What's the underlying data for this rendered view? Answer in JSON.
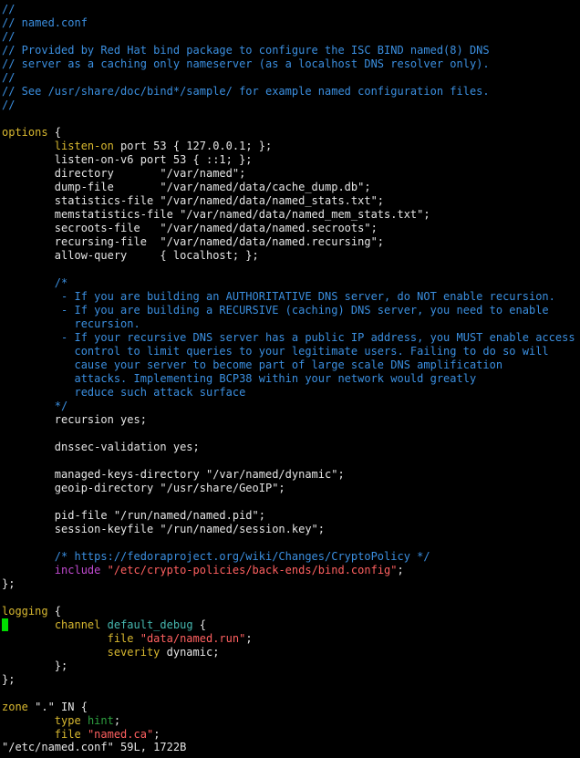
{
  "editor": {
    "lines": [
      [
        {
          "t": "//",
          "c": "comment"
        }
      ],
      [
        {
          "t": "// named.conf",
          "c": "comment"
        }
      ],
      [
        {
          "t": "//",
          "c": "comment"
        }
      ],
      [
        {
          "t": "// Provided by Red Hat bind package to configure the ISC BIND named(8) DNS",
          "c": "comment"
        }
      ],
      [
        {
          "t": "// server as a caching only nameserver (as a localhost DNS resolver only).",
          "c": "comment"
        }
      ],
      [
        {
          "t": "//",
          "c": "comment"
        }
      ],
      [
        {
          "t": "// See /usr/share/doc/bind*/sample/ for example named configuration files.",
          "c": "comment"
        }
      ],
      [
        {
          "t": "//",
          "c": "comment"
        }
      ],
      [
        {
          "t": "",
          "c": "plain"
        }
      ],
      [
        {
          "t": "options",
          "c": "keyword"
        },
        {
          "t": " {",
          "c": "plain"
        }
      ],
      [
        {
          "t": "        ",
          "c": "plain"
        },
        {
          "t": "listen-on",
          "c": "keyword"
        },
        {
          "t": " port 53 { 127.0.0.1; };",
          "c": "plain"
        }
      ],
      [
        {
          "t": "        listen-on-v6 port 53 { ::1; };",
          "c": "plain"
        }
      ],
      [
        {
          "t": "        directory       \"/var/named\";",
          "c": "plain"
        }
      ],
      [
        {
          "t": "        dump-file       \"/var/named/data/cache_dump.db\";",
          "c": "plain"
        }
      ],
      [
        {
          "t": "        statistics-file \"/var/named/data/named_stats.txt\";",
          "c": "plain"
        }
      ],
      [
        {
          "t": "        memstatistics-file \"/var/named/data/named_mem_stats.txt\";",
          "c": "plain"
        }
      ],
      [
        {
          "t": "        secroots-file   \"/var/named/data/named.secroots\";",
          "c": "plain"
        }
      ],
      [
        {
          "t": "        recursing-file  \"/var/named/data/named.recursing\";",
          "c": "plain"
        }
      ],
      [
        {
          "t": "        allow-query     { localhost; };",
          "c": "plain"
        }
      ],
      [
        {
          "t": "",
          "c": "plain"
        }
      ],
      [
        {
          "t": "        /*",
          "c": "comment"
        }
      ],
      [
        {
          "t": "         - If you are building an AUTHORITATIVE DNS server, do NOT enable recursion.",
          "c": "comment"
        }
      ],
      [
        {
          "t": "         - If you are building a RECURSIVE (caching) DNS server, you need to enable",
          "c": "comment"
        }
      ],
      [
        {
          "t": "           recursion.",
          "c": "comment"
        }
      ],
      [
        {
          "t": "         - If your recursive DNS server has a public IP address, you MUST enable access",
          "c": "comment"
        }
      ],
      [
        {
          "t": "           control to limit queries to your legitimate users. Failing to do so will",
          "c": "comment"
        }
      ],
      [
        {
          "t": "           cause your server to become part of large scale DNS amplification",
          "comment": "",
          "c": "comment"
        }
      ],
      [
        {
          "t": "           attacks. Implementing BCP38 within your network would greatly",
          "c": "comment"
        }
      ],
      [
        {
          "t": "           reduce such attack surface",
          "c": "comment"
        }
      ],
      [
        {
          "t": "        */",
          "c": "comment"
        }
      ],
      [
        {
          "t": "        recursion yes;",
          "c": "plain"
        }
      ],
      [
        {
          "t": "",
          "c": "plain"
        }
      ],
      [
        {
          "t": "        dnssec-validation yes;",
          "c": "plain"
        }
      ],
      [
        {
          "t": "",
          "c": "plain"
        }
      ],
      [
        {
          "t": "        managed-keys-directory \"/var/named/dynamic\";",
          "c": "plain"
        }
      ],
      [
        {
          "t": "        geoip-directory \"/usr/share/GeoIP\";",
          "c": "plain"
        }
      ],
      [
        {
          "t": "",
          "c": "plain"
        }
      ],
      [
        {
          "t": "        pid-file \"/run/named/named.pid\";",
          "c": "plain"
        }
      ],
      [
        {
          "t": "        session-keyfile \"/run/named/session.key\";",
          "c": "plain"
        }
      ],
      [
        {
          "t": "",
          "c": "plain"
        }
      ],
      [
        {
          "t": "        /* https://fedoraproject.org/wiki/Changes/CryptoPolicy */",
          "c": "comment"
        }
      ],
      [
        {
          "t": "        ",
          "c": "plain"
        },
        {
          "t": "include",
          "c": "include"
        },
        {
          "t": " ",
          "c": "plain"
        },
        {
          "t": "\"/etc/crypto-policies/back-ends/bind.config\"",
          "c": "string"
        },
        {
          "t": ";",
          "c": "plain"
        }
      ],
      [
        {
          "t": "};",
          "c": "plain"
        }
      ],
      [
        {
          "t": "",
          "c": "plain"
        }
      ],
      [
        {
          "t": "logging",
          "c": "keyword"
        },
        {
          "t": " {",
          "c": "plain"
        }
      ],
      [
        {
          "t": " ",
          "c": "cursor"
        },
        {
          "t": "       ",
          "c": "plain"
        },
        {
          "t": "channel",
          "c": "keyword"
        },
        {
          "t": " ",
          "c": "plain"
        },
        {
          "t": "default_debug",
          "c": "type"
        },
        {
          "t": " {",
          "c": "plain"
        }
      ],
      [
        {
          "t": "                ",
          "c": "plain"
        },
        {
          "t": "file",
          "c": "keyword"
        },
        {
          "t": " ",
          "c": "plain"
        },
        {
          "t": "\"data/named.run\"",
          "c": "string"
        },
        {
          "t": ";",
          "c": "plain"
        }
      ],
      [
        {
          "t": "                ",
          "c": "plain"
        },
        {
          "t": "severity",
          "c": "keyword"
        },
        {
          "t": " dynamic;",
          "c": "plain"
        }
      ],
      [
        {
          "t": "        };",
          "c": "plain"
        }
      ],
      [
        {
          "t": "};",
          "c": "plain"
        }
      ],
      [
        {
          "t": "",
          "c": "plain"
        }
      ],
      [
        {
          "t": "zone",
          "c": "keyword"
        },
        {
          "t": " \".\" IN {",
          "c": "plain"
        }
      ],
      [
        {
          "t": "        ",
          "c": "plain"
        },
        {
          "t": "type",
          "c": "keyword"
        },
        {
          "t": " ",
          "c": "plain"
        },
        {
          "t": "hint",
          "c": "hint"
        },
        {
          "t": ";",
          "c": "plain"
        }
      ],
      [
        {
          "t": "        ",
          "c": "plain"
        },
        {
          "t": "file",
          "c": "keyword"
        },
        {
          "t": " ",
          "c": "plain"
        },
        {
          "t": "\"named.ca\"",
          "c": "string"
        },
        {
          "t": ";",
          "c": "plain"
        }
      ]
    ]
  },
  "status_bar": {
    "text": "\"/etc/named.conf\" 59L, 1722B"
  },
  "colors": {
    "background": "#000000",
    "comment": "#3b8fe0",
    "keyword": "#d8b830",
    "string": "#ff6060",
    "cursor": "#00dd00"
  }
}
